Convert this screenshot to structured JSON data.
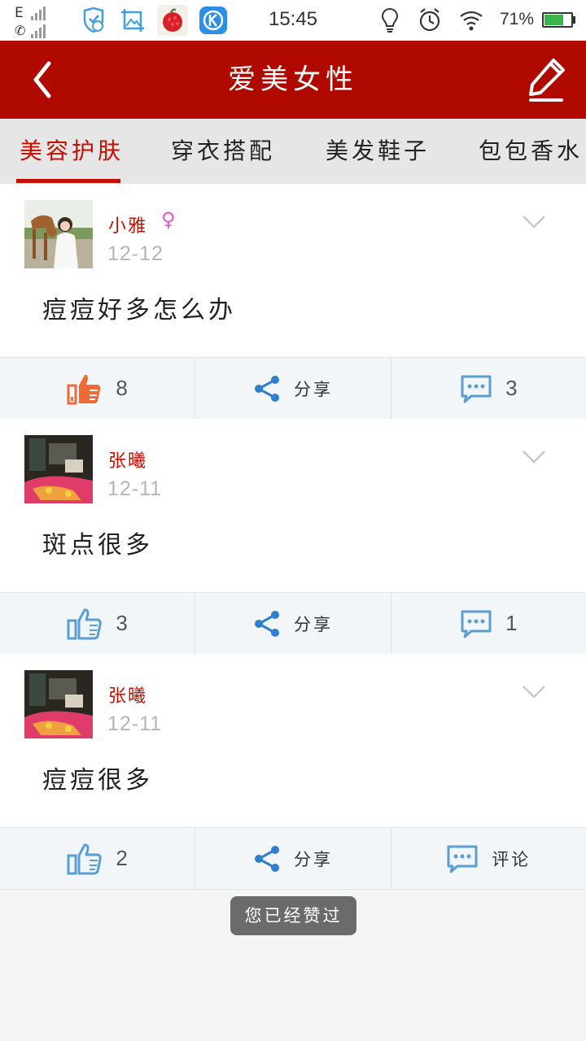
{
  "status_bar": {
    "network": "E",
    "time": "15:45",
    "battery": "71%",
    "battery_level": 0.71,
    "apps": [
      "shield-app-icon",
      "image-crop-app-icon",
      "lychee-app-icon",
      "kugou-app-icon"
    ],
    "indicators": [
      "lightbulb-icon",
      "alarm-icon",
      "wifi-icon"
    ]
  },
  "header": {
    "title": "爱美女性",
    "back_icon": "chevron-left-icon",
    "edit_icon": "pencil-icon",
    "background": "#b00a00"
  },
  "tabs": [
    {
      "label": "美容护肤",
      "active": true
    },
    {
      "label": "穿衣搭配",
      "active": false
    },
    {
      "label": "美发鞋子",
      "active": false
    },
    {
      "label": "包包香水",
      "active": false
    }
  ],
  "posts": [
    {
      "username": "小雅",
      "gender_icon": "♀",
      "date": "12-12",
      "text": "痘痘好多怎么办",
      "likes": "8",
      "liked": true,
      "share_label": "分享",
      "comments": "3"
    },
    {
      "username": "张曦",
      "date": "12-11",
      "text": "斑点很多",
      "likes": "3",
      "liked": false,
      "share_label": "分享",
      "comments": "1"
    },
    {
      "username": "张曦",
      "date": "12-11",
      "text": "痘痘很多",
      "likes": "2",
      "liked": false,
      "share_label": "分享",
      "comments": "评论"
    }
  ],
  "toast": "您已经赞过",
  "colors": {
    "accent": "#c40f00",
    "liked": "#f06a35",
    "icon_blue": "#5a9fd4",
    "share_blue": "#2f7fcf"
  }
}
